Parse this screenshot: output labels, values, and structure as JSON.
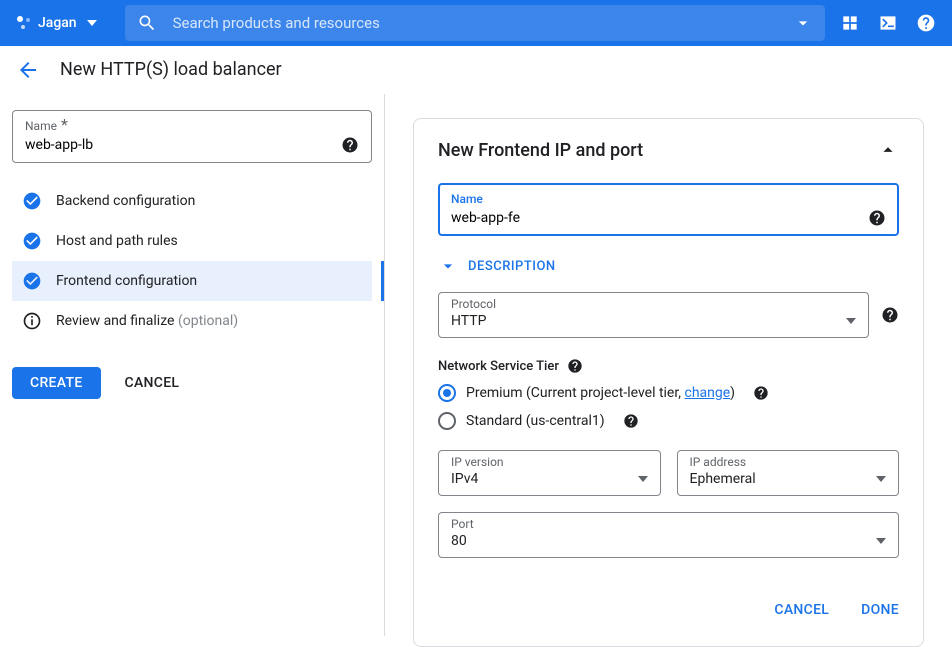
{
  "topbar": {
    "org": "Jagan",
    "search_placeholder": "Search products and resources"
  },
  "page": {
    "title": "New HTTP(S) load balancer"
  },
  "nameField": {
    "label": "Name",
    "required_mark": "*",
    "value": "web-app-lb"
  },
  "steps": [
    {
      "label": "Backend configuration",
      "status": "done"
    },
    {
      "label": "Host and path rules",
      "status": "done"
    },
    {
      "label": "Frontend configuration",
      "status": "done",
      "active": true
    },
    {
      "label": "Review and finalize",
      "status": "info",
      "optional": "(optional)"
    }
  ],
  "buttons": {
    "create": "CREATE",
    "cancel": "CANCEL"
  },
  "card": {
    "title": "New Frontend IP and port",
    "name": {
      "label": "Name",
      "value": "web-app-fe"
    },
    "description_toggle": "DESCRIPTION",
    "protocol": {
      "label": "Protocol",
      "value": "HTTP"
    },
    "tier": {
      "label": "Network Service Tier",
      "premium": "Premium (Current project-level tier, ",
      "change": "change",
      "premium_close": ")",
      "standard": "Standard (us-central1)"
    },
    "ipversion": {
      "label": "IP version",
      "value": "IPv4"
    },
    "ipaddress": {
      "label": "IP address",
      "value": "Ephemeral"
    },
    "port": {
      "label": "Port",
      "value": "80"
    },
    "actions": {
      "cancel": "CANCEL",
      "done": "DONE"
    }
  }
}
